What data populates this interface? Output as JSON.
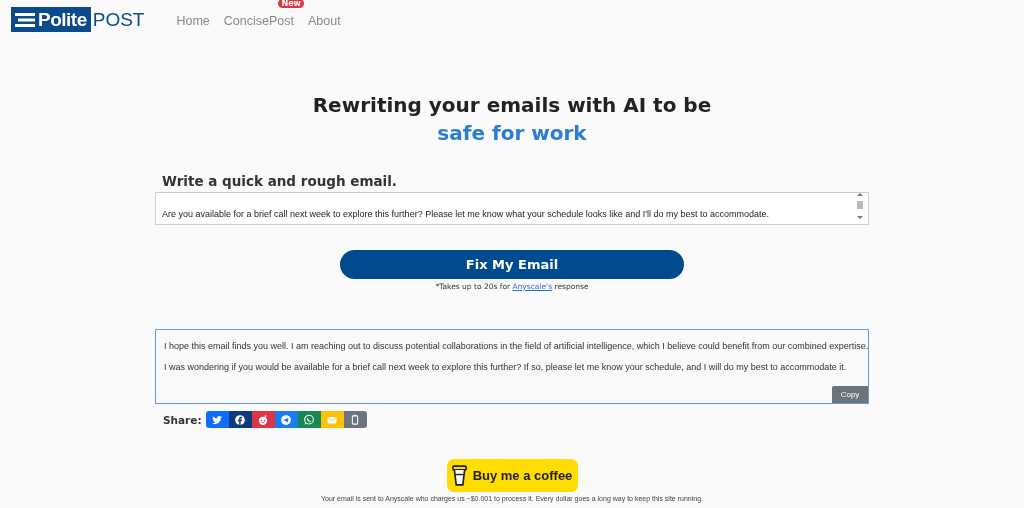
{
  "navbar": {
    "logo": {
      "part_1": "Polite",
      "part_2": "POST"
    },
    "links": [
      {
        "label": "Home"
      },
      {
        "label": "ConcisePost",
        "badge": "New"
      },
      {
        "label": "About"
      }
    ]
  },
  "hero": {
    "line_1": "Rewriting your emails with AI to be",
    "line_2": "safe for work"
  },
  "input": {
    "label": "Write a quick and rough email.",
    "value": "Are you available for a brief call next week to explore this further? Please let me know what your schedule looks like and I'll do my best to accommodate."
  },
  "submit": {
    "label": "Fix My Email",
    "note_before": "*Takes up to 20s for",
    "note_link": "Anyscale's",
    "note_after": "response"
  },
  "output": {
    "paragraphs": [
      "I hope this email finds you well. I am reaching out to discuss potential collaborations in the field of artificial intelligence, which I believe could benefit from our combined expertise.",
      "I was wondering if you would be available for a brief call next week to explore this further? If so, please let me know your schedule, and I will do my best to accommodate it."
    ],
    "copy_label": "Copy"
  },
  "share": {
    "label": "Share:",
    "buttons": [
      {
        "kind": "twitter",
        "color": "#0d6efd"
      },
      {
        "kind": "facebook",
        "color": "#0a3d7a"
      },
      {
        "kind": "reddit",
        "color": "#dc3545"
      },
      {
        "kind": "telegram",
        "color": "#1a7cf0"
      },
      {
        "kind": "whatsapp",
        "color": "#198754"
      },
      {
        "kind": "email",
        "color": "#ffc107"
      },
      {
        "kind": "copy",
        "color": "#6c757d"
      }
    ]
  },
  "coffee": {
    "label": "Buy me a coffee"
  },
  "footer_note": "Your email is sent to Anyscale who charges us ~$0.001 to process it. Every dollar goes a long way to keep this site running."
}
